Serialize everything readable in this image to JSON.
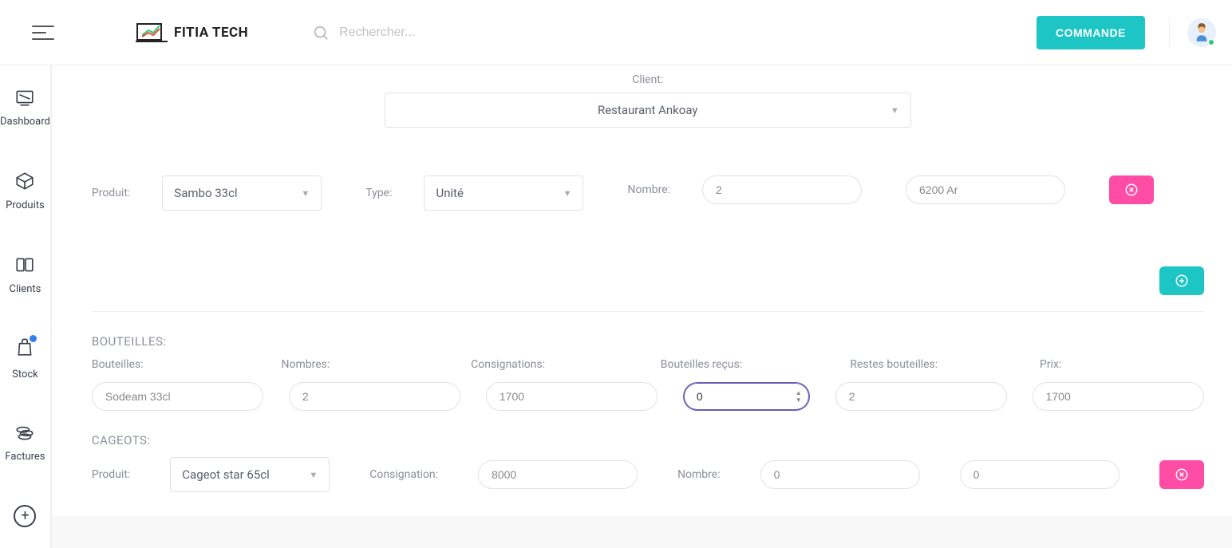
{
  "header": {
    "logo_text": "FITIA TECH",
    "search_placeholder": "Rechercher...",
    "commande_label": "COMMANDE"
  },
  "sidebar": {
    "items": [
      {
        "label": "Dashboard"
      },
      {
        "label": "Produits"
      },
      {
        "label": "Clients"
      },
      {
        "label": "Stock"
      },
      {
        "label": "Factures"
      }
    ]
  },
  "client": {
    "label": "Client:",
    "value": "Restaurant Ankoay"
  },
  "product_row": {
    "product_label": "Produit:",
    "product_value": "Sambo 33cl",
    "type_label": "Type:",
    "type_value": "Unité",
    "number_label": "Nombre:",
    "number_value": "2",
    "price_value": "6200 Ar"
  },
  "bottles": {
    "section_title": "BOUTEILLES:",
    "headers": {
      "bouteilles": "Bouteilles:",
      "nombres": "Nombres:",
      "consignations": "Consignations:",
      "recus": "Bouteilles reçus:",
      "restes": "Restes bouteilles:",
      "prix": "Prix:"
    },
    "row": {
      "bouteilles": "Sodeam 33cl",
      "nombres": "2",
      "consignations": "1700",
      "recus": "0",
      "restes": "2",
      "prix": "1700"
    }
  },
  "cageots": {
    "section_title": "CAGEOTS:",
    "product_label": "Produit:",
    "product_value": "Cageot star 65cl",
    "consignation_label": "Consignation:",
    "consignation_value": "8000",
    "number_label": "Nombre:",
    "number_value": "0",
    "second_value": "0"
  }
}
